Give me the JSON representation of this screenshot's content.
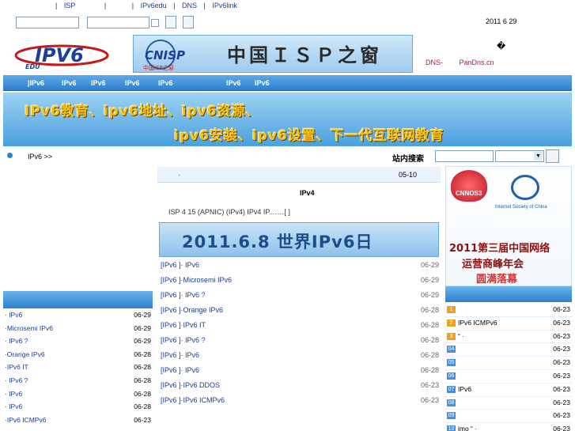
{
  "top_links": [
    "|",
    "ISP",
    "|",
    "|",
    "IPv6edu",
    "|",
    "DNS",
    "|",
    "IPv6link"
  ],
  "date": "2011 6 29",
  "glyph": "�",
  "dns_links": [
    "DNS-",
    "PanDns.cn"
  ],
  "logos": {
    "edu": "EDU IPV6",
    "cnisp_mark": "CNISP",
    "cnisp_sub": "中国ISP之窗",
    "cnisp_title": "中国ＩＳＰ之窗"
  },
  "nav": [
    "|IPv6",
    "IPv6",
    "IPv6",
    "IPv6",
    "IPv6",
    "IPv6",
    "IPv6"
  ],
  "banner": {
    "line1": "IPv6教育、ipv6地址、ipv6资源、",
    "line2": "ipv6安装、ipv6设置、下一代互联网教育"
  },
  "breadcrumb": "IPv6 >>",
  "search_label": "站内搜索",
  "center": {
    "head_title": "·",
    "head_date": "05-10",
    "title": "IPv4",
    "summary": "ISP   4 15        (APNIC)           (IPv4)                       IPv4           IP……[ ]",
    "ipv6day": "2011.6.8 世界IPv6日",
    "items": [
      {
        "title": "[IPv6    ]·      IPv6",
        "date": "06-29"
      },
      {
        "title": "[IPv6    ]·Microsemi           IPv6",
        "date": "06-29"
      },
      {
        "title": "[IPv6    ]·            IPv6     ?",
        "date": "06-29"
      },
      {
        "title": "[IPv6    ]·Orange          IPv6",
        "date": "06-28"
      },
      {
        "title": "[IPv6    ]·IPv6            IT",
        "date": "06-28"
      },
      {
        "title": "[IPv6    ]·    IPv6     ?",
        "date": "06-28"
      },
      {
        "title": "[IPv6    ]·            IPv6",
        "date": "06-28"
      },
      {
        "title": "[IPv6    ]·                 IPv6",
        "date": "06-28"
      },
      {
        "title": "[IPv6    ]·IPv6              DDOS",
        "date": "06-23"
      },
      {
        "title": "[IPv6    ]·IPv6 ICMPv6",
        "date": "06-23"
      }
    ]
  },
  "left_list": [
    {
      "title": "·          IPv6",
      "date": "06-29"
    },
    {
      "title": "·Microsemi             IPv6",
      "date": "06-29"
    },
    {
      "title": "·            IPv6     ?",
      "date": "06-29"
    },
    {
      "title": "·Orange          IPv6",
      "date": "06-28"
    },
    {
      "title": "·IPv6              IT",
      "date": "06-28"
    },
    {
      "title": "·      IPv6     ?",
      "date": "06-28"
    },
    {
      "title": "·             IPv6",
      "date": "06-28"
    },
    {
      "title": "·                  IPv6",
      "date": "06-28"
    },
    {
      "title": "·IPv6 ICMPv6",
      "date": "06-23"
    }
  ],
  "promo": {
    "cnnos": "CNNOS3",
    "isc_name": "Internet Society of China",
    "line1": "2011第三届中国网络",
    "line2": "运营商峰年会",
    "line3": "圆满落幕"
  },
  "right_list": [
    {
      "num": "1",
      "title": "",
      "date": "06-23",
      "color": "#f0a020"
    },
    {
      "num": "2",
      "title": "IPv6 ICMPv6",
      "date": "06-23",
      "color": "#f0a020"
    },
    {
      "num": "3",
      "title": "          “ ·",
      "date": "06-23",
      "color": "#f0a020"
    },
    {
      "num": "04",
      "title": "",
      "date": "06-23",
      "color": "#4a8fd8"
    },
    {
      "num": "05",
      "title": "",
      "date": "06-23",
      "color": "#4a8fd8"
    },
    {
      "num": "06",
      "title": "",
      "date": "06-23",
      "color": "#4a8fd8"
    },
    {
      "num": "07",
      "title": "IPv6",
      "date": "06-23",
      "color": "#4a8fd8"
    },
    {
      "num": "08",
      "title": "",
      "date": "06-23",
      "color": "#4a8fd8"
    },
    {
      "num": "09",
      "title": "",
      "date": "06-23",
      "color": "#4a8fd8"
    },
    {
      "num": "10",
      "title": "imo            “  ·",
      "date": "06-23",
      "color": "#4a8fd8"
    }
  ]
}
